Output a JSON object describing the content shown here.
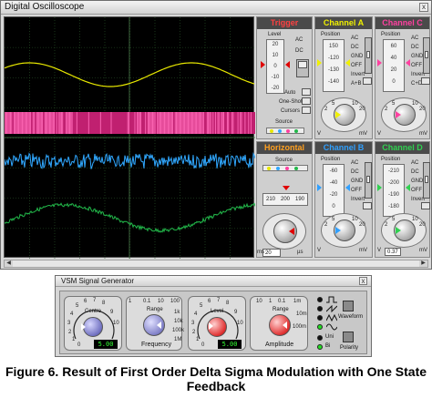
{
  "oscilloscope": {
    "title": "Digital Oscilloscope",
    "close": "x",
    "trigger": {
      "head": "Trigger",
      "level_label": "Level",
      "scale": [
        "20",
        "10",
        "0",
        "-10",
        "-20"
      ],
      "coupling": [
        "AC",
        "DC"
      ],
      "auto": "Auto",
      "one_shot": "One-Shot",
      "cursors": "Cursors",
      "source": "Source"
    },
    "channels": [
      {
        "name": "Channel A",
        "color": "#f0f000",
        "position_scale": [
          "150",
          "-120",
          "-130",
          "-140"
        ],
        "modes": [
          "AC",
          "DC",
          "GND",
          "OFF",
          "Invert",
          "A+B"
        ],
        "knob_scale": [
          "2",
          "5",
          "10",
          "20"
        ],
        "units": [
          "V",
          "mV"
        ]
      },
      {
        "name": "Channel C",
        "color": "#ff40a0",
        "position_scale": [
          "60",
          "40",
          "20",
          "0"
        ],
        "modes": [
          "AC",
          "DC",
          "GND",
          "OFF",
          "Invert",
          "C+D"
        ],
        "knob_scale": [
          "2",
          "5",
          "10",
          "20"
        ],
        "units": [
          "V",
          "mV"
        ]
      },
      {
        "name": "Channel B",
        "color": "#30a0ff",
        "position_scale": [
          "-60",
          "-40",
          "-20",
          "0"
        ],
        "modes": [
          "AC",
          "DC",
          "GND",
          "OFF",
          "Invert"
        ],
        "knob_scale": [
          "2",
          "5",
          "10",
          "20"
        ],
        "units": [
          "V",
          "mV"
        ]
      },
      {
        "name": "Channel D",
        "color": "#30d050",
        "position_scale": [
          "-210",
          "-200",
          "-190",
          "-180"
        ],
        "modes": [
          "AC",
          "DC",
          "GND",
          "OFF",
          "Invert"
        ],
        "knob_scale": [
          "2",
          "5",
          "10",
          "20"
        ],
        "units": [
          "V",
          "mV"
        ],
        "readout": "0.37"
      }
    ],
    "horizontal": {
      "head": "Horizontal",
      "source_label": "Source",
      "scale": [
        "210",
        "200",
        "190"
      ],
      "knob_units": [
        "ms",
        "µs"
      ],
      "readout": "20"
    }
  },
  "generator": {
    "title": "VSM Signal Generator",
    "close": "x",
    "centre": {
      "label": "Centre",
      "readout": "5.00",
      "scale": [
        "6",
        "7",
        "8",
        "5",
        "4",
        "3",
        "2",
        "1",
        "0",
        "9",
        "10"
      ]
    },
    "range_freq": {
      "label": "Range",
      "sublabel": "Frequency",
      "scale": [
        "1",
        "0.1",
        "10",
        "100",
        "1k",
        "10k",
        "100k",
        "1M"
      ]
    },
    "level": {
      "label": "Level",
      "readout": "5.00",
      "scale": [
        "6",
        "7",
        "8",
        "5",
        "4",
        "3",
        "2",
        "1",
        "0",
        "9",
        "10"
      ]
    },
    "range_amp": {
      "label": "Range",
      "sublabel": "Amplitude",
      "scale": [
        "10",
        "1",
        "0.1",
        "1m",
        "10m",
        "100m"
      ]
    },
    "waveform_button": "Waveform",
    "polarity_button": "Polarity",
    "polarity_options": [
      "Uni",
      "Bi"
    ]
  },
  "caption": "Figure 6. Result of First Order Delta Sigma Modulation with One State Feedback"
}
